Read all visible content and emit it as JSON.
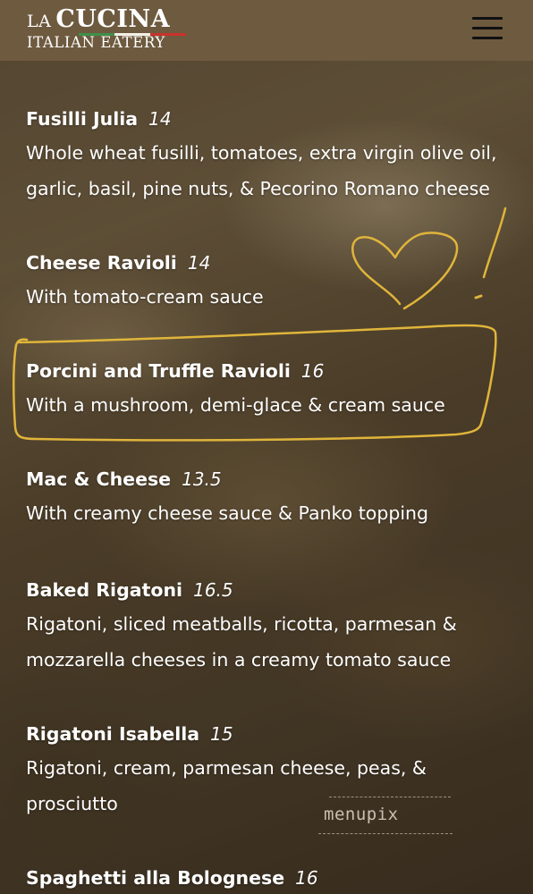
{
  "header": {
    "logo_la": "LA",
    "logo_cucina": "CUCINA",
    "logo_sub": "ITALIAN EATERY",
    "menu_icon": "hamburger-menu-icon",
    "background_color": "#6e5a3f"
  },
  "menu": {
    "items": [
      {
        "name": "Fusilli Julia",
        "price": "14",
        "description_lines": [
          "Whole wheat fusilli, tomatoes, extra virgin olive oil,",
          "garlic, basil, pine nuts, & Pecorino Romano cheese"
        ]
      },
      {
        "name": "Cheese Ravioli",
        "price": "14",
        "description_lines": [
          "With tomato-cream sauce"
        ]
      },
      {
        "name": "Porcini and Truffle Ravioli",
        "price": "16",
        "description_lines": [
          "With a mushroom, demi-glace & cream sauce"
        ]
      },
      {
        "name": "Mac & Cheese",
        "price": "13.5",
        "description_lines": [
          "With creamy cheese sauce & Panko topping"
        ]
      },
      {
        "name": "Baked Rigatoni",
        "price": "16.5",
        "description_lines": [
          "Rigatoni, sliced meatballs, ricotta, parmesan &",
          "mozzarella cheeses in a creamy tomato sauce"
        ]
      },
      {
        "name": "Rigatoni Isabella",
        "price": "15",
        "description_lines": [
          "Rigatoni, cream, parmesan cheese, peas, &",
          "prosciutto"
        ]
      },
      {
        "name": "Spaghetti alla Bolognese",
        "price": "16",
        "description_lines": []
      }
    ]
  },
  "annotation": {
    "color": "#e0b53a",
    "highlighted_item": "Porcini and Truffle Ravioli",
    "doodle": "heart-with-exclamation"
  },
  "watermark": {
    "text": "menupix"
  }
}
